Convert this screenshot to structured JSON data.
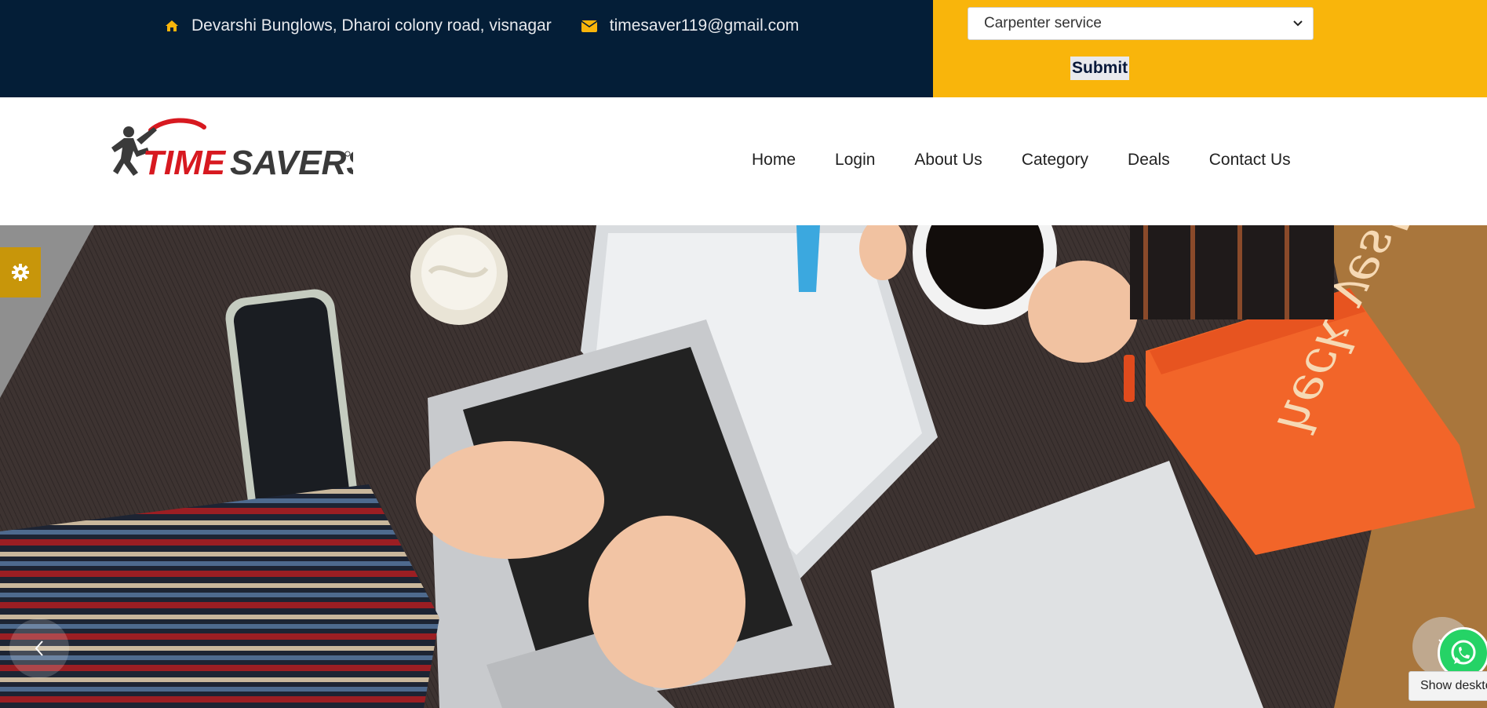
{
  "topbar": {
    "address": "Devarshi Bunglows, Dharoi colony road, visnagar",
    "email": "timesaver119@gmail.com",
    "service_select": {
      "selected": "Carpenter service"
    },
    "submit_label": "Submit"
  },
  "header": {
    "logo_text": "TIMESAVERS",
    "nav": [
      "Home",
      "Login",
      "About Us",
      "Category",
      "Deals",
      "Contact Us"
    ]
  },
  "hero": {
    "pouch_text": "heck yes!"
  },
  "widgets": {
    "tooltip": "Show desktop"
  },
  "icons": {
    "address": "home-icon",
    "email": "envelope-icon",
    "settings": "gear-icon",
    "prev": "chevron-left-icon",
    "next": "chevron-right-icon",
    "whatsapp": "whatsapp-icon"
  },
  "colors": {
    "topbar_bg": "#041e37",
    "accent_yellow": "#f9b50b",
    "settings_tab": "#c8960a",
    "logo_red": "#d71920",
    "whatsapp_green": "#25d366"
  }
}
